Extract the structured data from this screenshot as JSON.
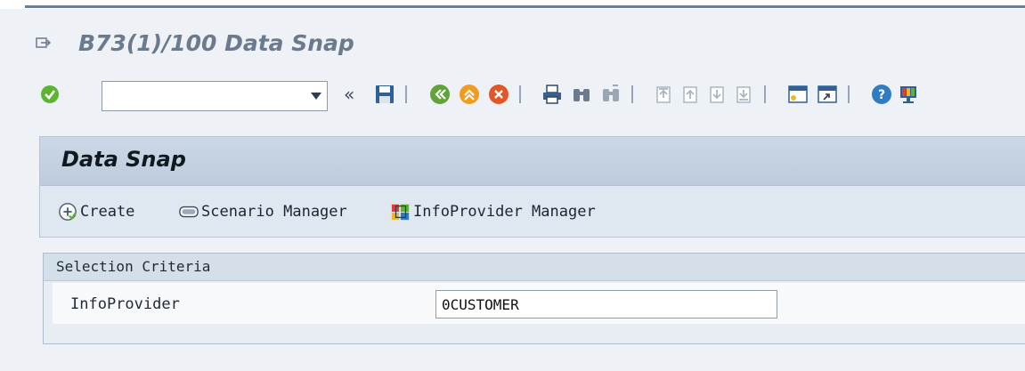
{
  "window": {
    "title": "B73(1)/100 Data Snap"
  },
  "toolbar": {
    "command_field": {
      "value": "",
      "placeholder": ""
    },
    "collapse_glyph": "«",
    "icons": [
      "enter-icon",
      "dropdown-icon",
      "save-icon",
      "back-icon",
      "exit-icon",
      "cancel-icon",
      "print-icon",
      "find-icon",
      "find-next-icon",
      "first-page-icon",
      "previous-page-icon",
      "next-page-icon",
      "last-page-icon",
      "new-session-icon",
      "shortcut-icon",
      "help-icon",
      "customize-layout-icon"
    ]
  },
  "app": {
    "title": "Data Snap",
    "buttons": {
      "create": "Create",
      "scenario_manager": "Scenario Manager",
      "infoprovider_manager": "InfoProvider Manager"
    }
  },
  "selection": {
    "title": "Selection Criteria",
    "fields": [
      {
        "label": "InfoProvider",
        "value": "0CUSTOMER"
      }
    ]
  },
  "colors": {
    "background": "#eef2f6",
    "title_text": "#6b7a8d",
    "panel_header": "#c6d3e2",
    "group_header": "#d5dfea",
    "enter_green": "#5cb531",
    "exit_orange": "#f29b21",
    "cancel_red": "#e2572a",
    "back_green": "#5fa33a"
  }
}
